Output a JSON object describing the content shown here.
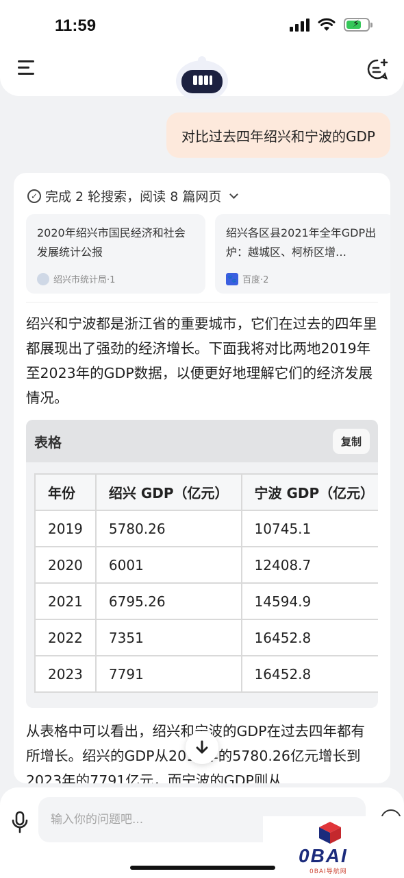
{
  "status_bar": {
    "time": "11:59"
  },
  "user_message": "对比过去四年绍兴和宁波的GDP",
  "search_summary": "完成 2 轮搜索，阅读 8 篇网页",
  "references": [
    {
      "title": "2020年绍兴市国民经济和社会发展统计公报",
      "source": "绍兴市统计局·1"
    },
    {
      "title": "绍兴各区县2021年全年GDP出炉：越城区、柯桥区增…",
      "source": "百度·2"
    }
  ],
  "intro_text": "绍兴和宁波都是浙江省的重要城市，它们在过去的四年里都展现出了强劲的经济增长。下面我将对比两地2019年至2023年的GDP数据，以便更好地理解它们的经济发展情况。",
  "table_block": {
    "title": "表格",
    "copy_label": "复制",
    "headers": [
      "年份",
      "绍兴 GDP（亿元）",
      "宁波 GDP（亿元）"
    ],
    "rows": [
      [
        "2019",
        "5780.26",
        "10745.1"
      ],
      [
        "2020",
        "6001",
        "12408.7"
      ],
      [
        "2021",
        "6795.26",
        "14594.9"
      ],
      [
        "2022",
        "7351",
        "16452.8"
      ],
      [
        "2023",
        "7791",
        "16452.8"
      ]
    ]
  },
  "conclusion_text": "从表格中可以看出，绍兴和宁波的GDP在过去四年都有所增长。绍兴的GDP从2019年的5780.26亿元增长到2023年的7791亿元，而宁波的GDP则从",
  "input": {
    "placeholder": "输入你的问题吧..."
  },
  "watermark": {
    "brand": "0BAI",
    "sub": "0BAI导航网"
  },
  "colors": {
    "user_bubble": "#fde9dc",
    "page_bg": "#f1f2f4",
    "battery": "#35c759"
  }
}
